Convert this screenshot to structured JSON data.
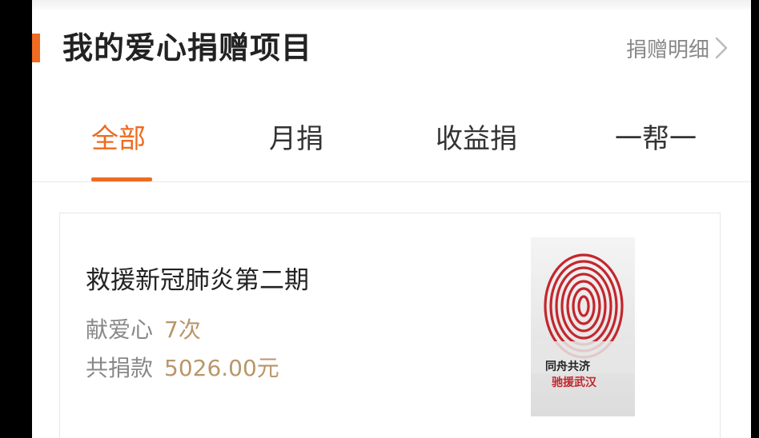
{
  "header": {
    "title": "我的爱心捐赠项目",
    "detail_link": "捐赠明细"
  },
  "tabs": [
    {
      "label": "全部",
      "active": true
    },
    {
      "label": "月捐",
      "active": false
    },
    {
      "label": "收益捐",
      "active": false
    },
    {
      "label": "一帮一",
      "active": false
    }
  ],
  "project": {
    "name": "救援新冠肺炎第二期",
    "donations_label": "献爱心",
    "donations_value": "7次",
    "total_label": "共捐款",
    "total_value": "5026.00元",
    "image_text_line1": "同舟共济",
    "image_text_line2": "驰援武汉"
  },
  "colors": {
    "accent": "#ee6b21",
    "value_gold": "#b9966a",
    "fingerprint_red": "#c4262d"
  }
}
